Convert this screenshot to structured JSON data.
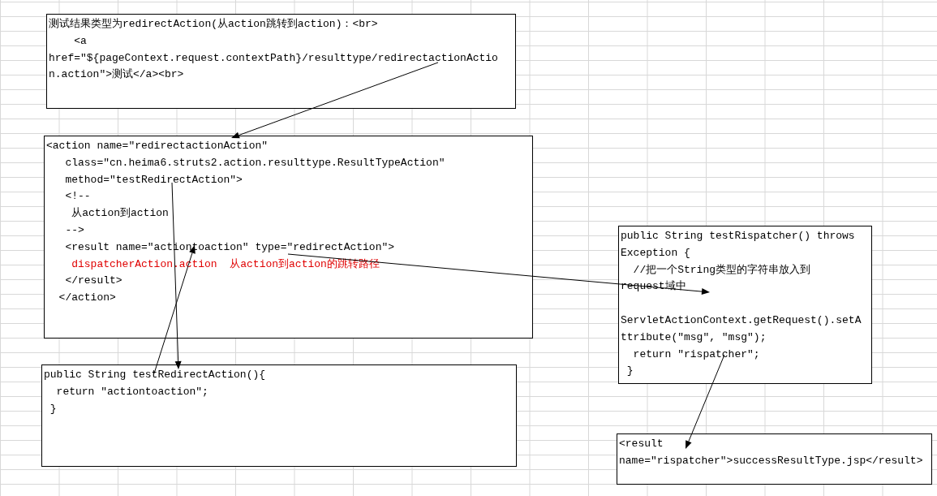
{
  "text_boxes": [
    {
      "blocks": [
        [
          {
            "text": "测试结果类型为redirectAction(从action跳转到action)：<br>",
            "kind": "code"
          },
          {
            "text": "    <a",
            "kind": "code"
          },
          {
            "text": "href=\"${pageContext.request.contextPath}/resulttype/redirectactionActio",
            "kind": "code"
          },
          {
            "text": "n.action\">测试</a><br>",
            "kind": "code"
          }
        ]
      ]
    },
    {
      "blocks": [
        [
          {
            "text": "<action name=\"redirectactionAction\"",
            "kind": "code"
          },
          {
            "text": "   class=\"cn.heima6.struts2.action.resulttype.ResultTypeAction\"",
            "kind": "code"
          },
          {
            "text": "   method=\"testRedirectAction\">",
            "kind": "code"
          },
          {
            "text": "   <!--",
            "kind": "code"
          },
          {
            "text": "    从action到action",
            "kind": "code"
          },
          {
            "text": "   -->",
            "kind": "code"
          },
          {
            "text": "   <result name=\"actiontoaction\" type=\"redirectAction\">",
            "kind": "code"
          },
          {
            "text": "    dispatcherAction.action  从action到action的跳转路径",
            "kind": "comment"
          },
          {
            "text": "   </result>",
            "kind": "code"
          },
          {
            "text": "  </action>",
            "kind": "code"
          }
        ]
      ]
    },
    {
      "blocks": [
        [
          {
            "text": "public String testRispatcher() throws",
            "kind": "code"
          },
          {
            "text": "Exception {",
            "kind": "code"
          },
          {
            "text": "  //把一个String类型的字符串放入到",
            "kind": "code"
          },
          {
            "text": "request域中",
            "kind": "code"
          }
        ],
        [
          {
            "text": "ServletActionContext.getRequest().setA",
            "kind": "code"
          },
          {
            "text": "ttribute(\"msg\", \"msg\");",
            "kind": "code"
          },
          {
            "text": "  return \"rispatcher\";",
            "kind": "code"
          },
          {
            "text": " }",
            "kind": "code"
          }
        ]
      ]
    },
    {
      "blocks": [
        [
          {
            "text": "public String testRedirectAction(){",
            "kind": "code"
          },
          {
            "text": "  return \"actiontoaction\";",
            "kind": "code"
          },
          {
            "text": " }",
            "kind": "code"
          }
        ]
      ]
    },
    {
      "blocks": [
        [
          {
            "text": "<result",
            "kind": "code"
          },
          {
            "text": "name=\"rispatcher\">successResultType.jsp</result>",
            "kind": "code"
          }
        ]
      ]
    }
  ]
}
